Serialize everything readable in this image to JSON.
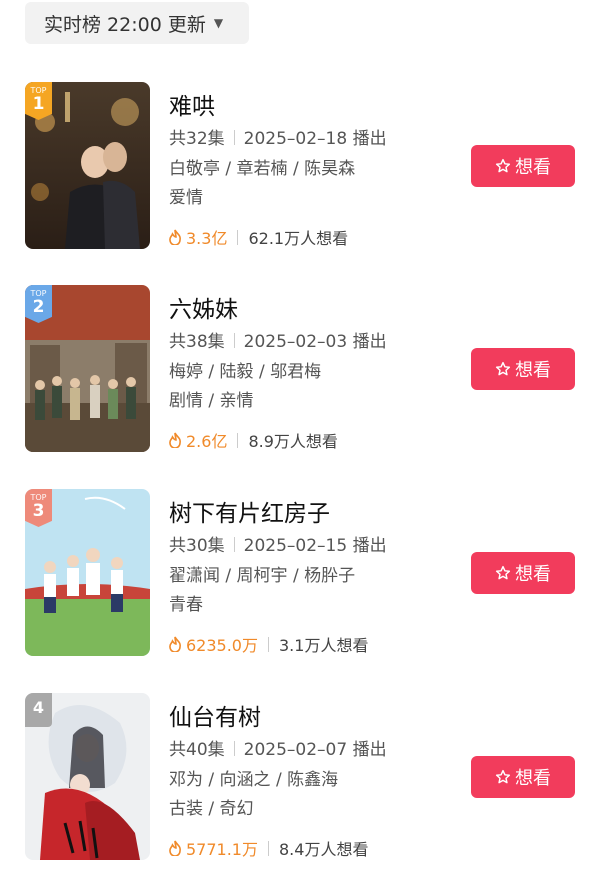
{
  "header": {
    "update_label": "实时榜 22:00 更新"
  },
  "rank_badge_text": "TOP",
  "colors": {
    "accent": "#f23c5c",
    "heat": "#f08a2a",
    "rank1": "#f5a623",
    "rank2": "#6aa8e8",
    "rank3": "#ee8a7a",
    "rank_plain": "#a8a8a8"
  },
  "items": [
    {
      "rank": "1",
      "title": "难哄",
      "episodes": "共32集",
      "date": "2025–02–18 播出",
      "cast": "白敬亭 / 章若楠 / 陈昊森",
      "genre": "爱情",
      "heat": "3.3亿",
      "want_count": "62.1万人想看",
      "button": "想看",
      "poster_icon": "romance-drama-poster"
    },
    {
      "rank": "2",
      "title": "六姊妹",
      "episodes": "共38集",
      "date": "2025–02–03 播出",
      "cast": "梅婷 / 陆毅 / 邬君梅",
      "genre": "剧情 / 亲情",
      "heat": "2.6亿",
      "want_count": "8.9万人想看",
      "button": "想看",
      "poster_icon": "family-drama-poster"
    },
    {
      "rank": "3",
      "title": "树下有片红房子",
      "episodes": "共30集",
      "date": "2025–02–15 播出",
      "cast": "翟潇闻 / 周柯宇 / 杨肸子",
      "genre": "青春",
      "heat": "6235.0万",
      "want_count": "3.1万人想看",
      "button": "想看",
      "poster_icon": "youth-drama-poster"
    },
    {
      "rank": "4",
      "title": "仙台有树",
      "episodes": "共40集",
      "date": "2025–02–07 播出",
      "cast": "邓为 / 向涵之 / 陈鑫海",
      "genre": "古装 / 奇幻",
      "heat": "5771.1万",
      "want_count": "8.4万人想看",
      "button": "想看",
      "poster_icon": "fantasy-drama-poster"
    }
  ]
}
